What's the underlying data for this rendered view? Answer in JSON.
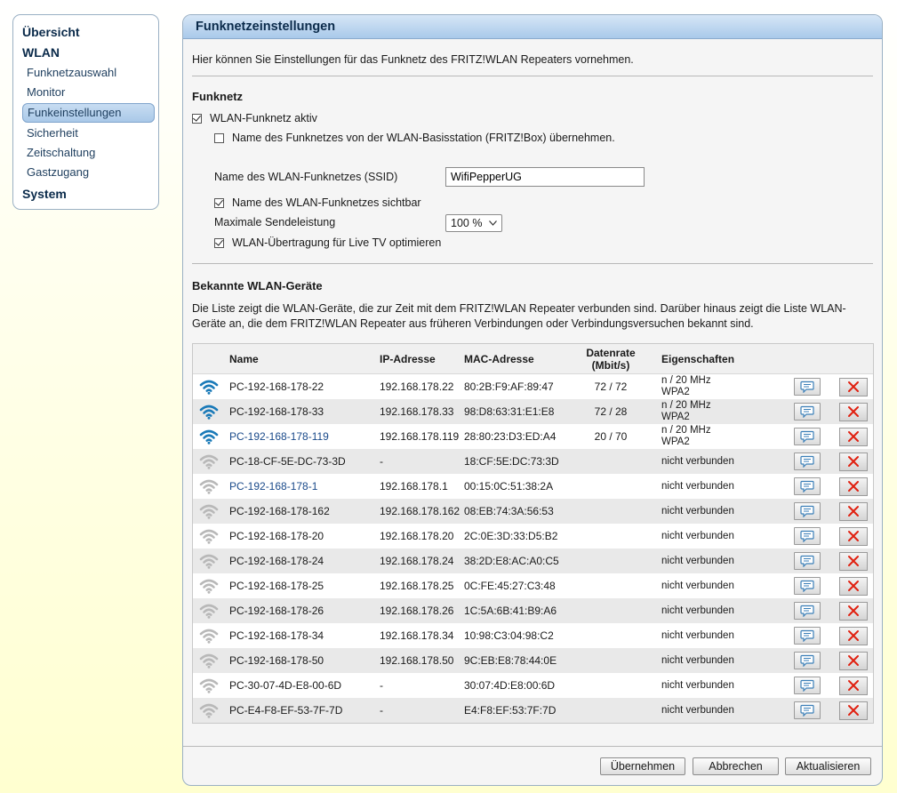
{
  "sidebar": {
    "overview": "Übersicht",
    "wlan": "WLAN",
    "items": [
      "Funknetzauswahl",
      "Monitor",
      "Funkeinstellungen",
      "Sicherheit",
      "Zeitschaltung",
      "Gastzugang"
    ],
    "active": "Funkeinstellungen",
    "system": "System"
  },
  "panel": {
    "title": "Funknetzeinstellungen",
    "intro": "Hier können Sie Einstellungen für das Funknetz des FRITZ!WLAN Repeaters vornehmen."
  },
  "funknetz": {
    "heading": "Funknetz",
    "wlan_active_label": "WLAN-Funknetz aktiv",
    "wlan_active_checked": true,
    "adopt_name_label": "Name des Funknetzes von der WLAN-Basisstation (FRITZ!Box) übernehmen.",
    "adopt_name_checked": false,
    "ssid_label": "Name des WLAN-Funknetzes (SSID)",
    "ssid_value": "WifiPepperUG",
    "visible_label": "Name des WLAN-Funknetzes sichtbar",
    "visible_checked": true,
    "power_label": "Maximale Sendeleistung",
    "power_value": "100 %",
    "livetv_label": "WLAN-Übertragung für Live TV optimieren",
    "livetv_checked": true
  },
  "devices": {
    "heading": "Bekannte WLAN-Geräte",
    "description": "Die Liste zeigt die WLAN-Geräte, die zur Zeit mit dem FRITZ!WLAN Repeater verbunden sind. Darüber hinaus zeigt die Liste WLAN-Geräte an, die dem FRITZ!WLAN Repeater aus früheren Verbindungen oder Verbindungsversuchen bekannt sind.",
    "columns": {
      "name": "Name",
      "ip": "IP-Adresse",
      "mac": "MAC-Adresse",
      "rate_line1": "Datenrate",
      "rate_line2": "(Mbit/s)",
      "props": "Eigenschaften"
    },
    "rows": [
      {
        "connected": true,
        "link": false,
        "name": "PC-192-168-178-22",
        "ip": "192.168.178.22",
        "mac": "80:2B:F9:AF:89:47",
        "rate": "72 / 72",
        "prop1": "n / 20 MHz",
        "prop2": "WPA2"
      },
      {
        "connected": true,
        "link": false,
        "name": "PC-192-168-178-33",
        "ip": "192.168.178.33",
        "mac": "98:D8:63:31:E1:E8",
        "rate": "72 / 28",
        "prop1": "n / 20 MHz",
        "prop2": "WPA2"
      },
      {
        "connected": true,
        "link": true,
        "name": "PC-192-168-178-119",
        "ip": "192.168.178.119",
        "mac": "28:80:23:D3:ED:A4",
        "rate": "20 / 70",
        "prop1": "n / 20 MHz",
        "prop2": "WPA2"
      },
      {
        "connected": false,
        "link": false,
        "name": "PC-18-CF-5E-DC-73-3D",
        "ip": "-",
        "mac": "18:CF:5E:DC:73:3D",
        "rate": "",
        "prop1": "nicht verbunden",
        "prop2": ""
      },
      {
        "connected": false,
        "link": true,
        "name": "PC-192-168-178-1",
        "ip": "192.168.178.1",
        "mac": "00:15:0C:51:38:2A",
        "rate": "",
        "prop1": "nicht verbunden",
        "prop2": ""
      },
      {
        "connected": false,
        "link": false,
        "name": "PC-192-168-178-162",
        "ip": "192.168.178.162",
        "mac": "08:EB:74:3A:56:53",
        "rate": "",
        "prop1": "nicht verbunden",
        "prop2": ""
      },
      {
        "connected": false,
        "link": false,
        "name": "PC-192-168-178-20",
        "ip": "192.168.178.20",
        "mac": "2C:0E:3D:33:D5:B2",
        "rate": "",
        "prop1": "nicht verbunden",
        "prop2": ""
      },
      {
        "connected": false,
        "link": false,
        "name": "PC-192-168-178-24",
        "ip": "192.168.178.24",
        "mac": "38:2D:E8:AC:A0:C5",
        "rate": "",
        "prop1": "nicht verbunden",
        "prop2": ""
      },
      {
        "connected": false,
        "link": false,
        "name": "PC-192-168-178-25",
        "ip": "192.168.178.25",
        "mac": "0C:FE:45:27:C3:48",
        "rate": "",
        "prop1": "nicht verbunden",
        "prop2": ""
      },
      {
        "connected": false,
        "link": false,
        "name": "PC-192-168-178-26",
        "ip": "192.168.178.26",
        "mac": "1C:5A:6B:41:B9:A6",
        "rate": "",
        "prop1": "nicht verbunden",
        "prop2": ""
      },
      {
        "connected": false,
        "link": false,
        "name": "PC-192-168-178-34",
        "ip": "192.168.178.34",
        "mac": "10:98:C3:04:98:C2",
        "rate": "",
        "prop1": "nicht verbunden",
        "prop2": ""
      },
      {
        "connected": false,
        "link": false,
        "name": "PC-192-168-178-50",
        "ip": "192.168.178.50",
        "mac": "9C:EB:E8:78:44:0E",
        "rate": "",
        "prop1": "nicht verbunden",
        "prop2": ""
      },
      {
        "connected": false,
        "link": false,
        "name": "PC-30-07-4D-E8-00-6D",
        "ip": "-",
        "mac": "30:07:4D:E8:00:6D",
        "rate": "",
        "prop1": "nicht verbunden",
        "prop2": ""
      },
      {
        "connected": false,
        "link": false,
        "name": "PC-E4-F8-EF-53-7F-7D",
        "ip": "-",
        "mac": "E4:F8:EF:53:7F:7D",
        "rate": "",
        "prop1": "nicht verbunden",
        "prop2": ""
      }
    ],
    "row_icons": {
      "signal": "wifi-icon",
      "edit": "edit-icon",
      "delete": "delete-icon"
    }
  },
  "buttons": {
    "apply": "Übernehmen",
    "cancel": "Abbrechen",
    "refresh": "Aktualisieren"
  },
  "colors": {
    "wifi_connected": "#1a7ab8",
    "wifi_disconnected": "#b8b8b8",
    "delete_x": "#e02010",
    "header_blue": "#a9c9ea"
  }
}
